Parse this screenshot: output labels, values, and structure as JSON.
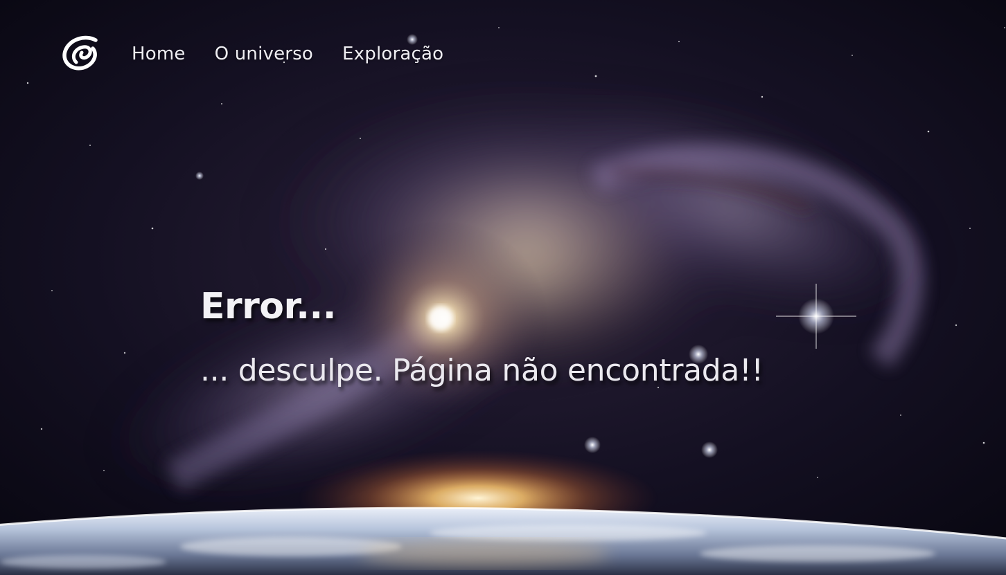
{
  "nav": {
    "logo_icon": "swirl-logo-icon",
    "items": [
      {
        "label": "Home"
      },
      {
        "label": "O universo"
      },
      {
        "label": "Exploração"
      }
    ]
  },
  "hero": {
    "title": "Error...",
    "subtitle": "... desculpe. Página não encontrada!!"
  },
  "background": {
    "description_icon": "galaxy-earth-background",
    "colors": {
      "space": "#0b0a18",
      "nebula": "#8f7fb4",
      "core": "#f6e2b0",
      "earth": "#cfd8ea",
      "sunrise": "#ffb347"
    }
  }
}
